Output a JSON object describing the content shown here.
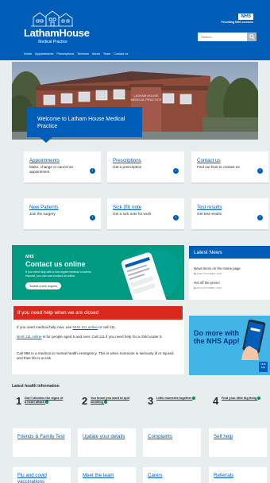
{
  "header": {
    "practice_name": "LathamHouse",
    "practice_sub": "Medical Practice",
    "nhs_badge": "NHS",
    "nhs_tagline": "Providing NHS services",
    "search_placeholder": "Search...",
    "nav": [
      "Home",
      "Appointments",
      "Prescriptions",
      "Services",
      "About",
      "Team",
      "Contact us"
    ]
  },
  "hero": {
    "sign_text": "LATHAM HOUSE MEDICAL PRACTICE",
    "welcome": "Welcome to Latham House Medical Practice"
  },
  "cards": [
    {
      "title": "Appointments",
      "desc": "Make, change or cancel an appointment"
    },
    {
      "title": "Prescriptions",
      "desc": "Get a prescription"
    },
    {
      "title": "Contact us",
      "desc": "Find out how to contact us"
    },
    {
      "title": "New Patients",
      "desc": "Join the surgery"
    },
    {
      "title": "Sick (fit) note",
      "desc": "Get a sick note for work"
    },
    {
      "title": "Test results",
      "desc": "Get test results"
    }
  ],
  "contact_online": {
    "nhs": "NHS",
    "title": "Contact us online",
    "desc": "If you need help with a non-urgent medical or admin request, you can now contact us online.",
    "button": "Submit a new request"
  },
  "news": {
    "heading": "Latest News",
    "items": [
      {
        "title": "News items on the Home page",
        "date": "22ND OCTOBER, 2020"
      },
      {
        "title": "Hot off the press!",
        "date": "20TH OCTOBER, 2020"
      }
    ]
  },
  "closed": {
    "heading": "If you need help when we are closed",
    "p1_pre": "If you need medical help now, use ",
    "p1_link": "NHS 111 online",
    "p1_post": " or call 111.",
    "p2_link": "NHS 111 online",
    "p2_post": " is for people aged 5 and over. Call 111 if you need help for a child under 5.",
    "p3": "Call 999 in a medical or mental health emergency. This is when someone is seriously ill or injured and their life is at risk."
  },
  "app_panel": {
    "text": "Do more with the NHS App!",
    "badge": "NHS App"
  },
  "health_info": {
    "title": "Latest health information",
    "items": [
      {
        "num": "1",
        "text": "Don't dismiss the signs of a heart attack"
      },
      {
        "num": "2",
        "text": "You know you want to quit smoking"
      },
      {
        "num": "3",
        "text": "Little moments together"
      },
      {
        "num": "4",
        "text": "Find your little big thing"
      }
    ]
  },
  "quick_links": [
    "Friends & Family Test",
    "Update your details",
    "Complaints",
    "Self help",
    "Flu and covid vaccinations",
    "Meet the team",
    "Carers",
    "Referrals"
  ],
  "colors": {
    "nhs_blue": "#005eb8",
    "green": "#009a82",
    "red": "#da291c",
    "light_blue": "#41b6e6"
  }
}
